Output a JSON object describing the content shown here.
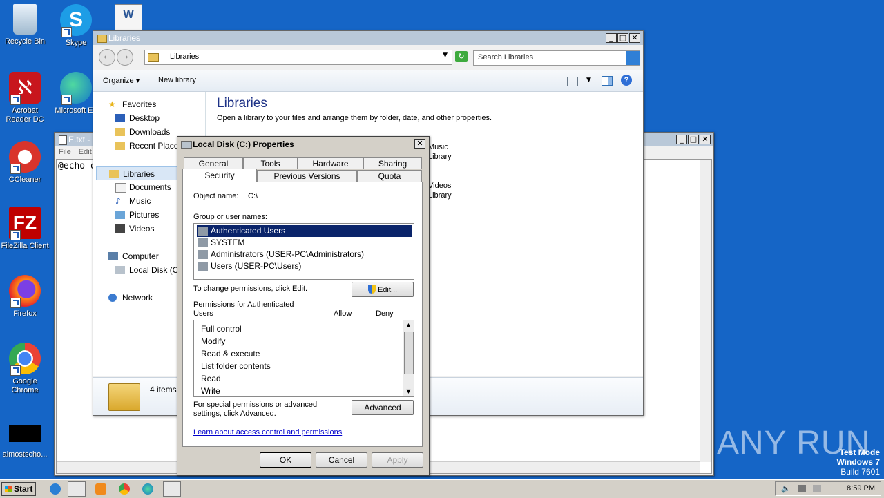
{
  "desktop": {
    "icons": [
      {
        "label": "Recycle Bin"
      },
      {
        "label": "Skype"
      },
      {
        "label": "Acrobat Reader DC"
      },
      {
        "label": "Microsoft Ed"
      },
      {
        "label": "CCleaner"
      },
      {
        "label": "FileZilla Client"
      },
      {
        "label": "Firefox"
      },
      {
        "label": "Google Chrome"
      },
      {
        "label": "almostscho..."
      }
    ],
    "watermark": {
      "brand": "ANY  RUN",
      "test_mode": "Test Mode",
      "os": "Windows 7",
      "build": "Build 7601"
    }
  },
  "notepad": {
    "title": "E.txt -",
    "menu": [
      "File",
      "Edit"
    ],
    "content": "@echo o"
  },
  "explorer": {
    "title": "Libraries",
    "address": "Libraries",
    "search_placeholder": "Search Libraries",
    "toolbar": {
      "organize": "Organize",
      "new_library": "New library"
    },
    "heading": "Libraries",
    "subheading": "Open a library to your files and arrange them by folder, date, and other properties.",
    "nav": {
      "favorites": "Favorites",
      "favorites_items": [
        "Desktop",
        "Downloads",
        "Recent Places"
      ],
      "libraries": "Libraries",
      "libraries_items": [
        "Documents",
        "Music",
        "Pictures",
        "Videos"
      ],
      "computer": "Computer",
      "computer_items": [
        "Local Disk (C:)"
      ],
      "network": "Network"
    },
    "tiles": [
      {
        "name": "Music",
        "type": "Library"
      },
      {
        "name": "Videos",
        "type": "Library"
      }
    ],
    "status": "4 items"
  },
  "dialog": {
    "title": "Local Disk (C:) Properties",
    "tabs_row1": [
      "General",
      "Tools",
      "Hardware",
      "Sharing"
    ],
    "tabs_row2": [
      "Security",
      "Previous Versions",
      "Quota"
    ],
    "active_tab": "Security",
    "object_label": "Object name:",
    "object_value": "C:\\",
    "group_label": "Group or user names:",
    "users": [
      "Authenticated Users",
      "SYSTEM",
      "Administrators (USER-PC\\Administrators)",
      "Users (USER-PC\\Users)"
    ],
    "change_text": "To change permissions, click Edit.",
    "edit_button": "Edit...",
    "perm_label": "Permissions for Authenticated Users",
    "allow_col": "Allow",
    "deny_col": "Deny",
    "permissions": [
      "Full control",
      "Modify",
      "Read & execute",
      "List folder contents",
      "Read",
      "Write"
    ],
    "special_text": "For special permissions or advanced settings, click Advanced.",
    "advanced_button": "Advanced",
    "learn_link": "Learn about access control and permissions",
    "ok": "OK",
    "cancel": "Cancel",
    "apply": "Apply"
  },
  "taskbar": {
    "start": "Start",
    "clock": "8:59 PM"
  },
  "colors": {
    "desktop": "#1565c6",
    "selection": "#0a246a",
    "link": "#0000cc"
  }
}
